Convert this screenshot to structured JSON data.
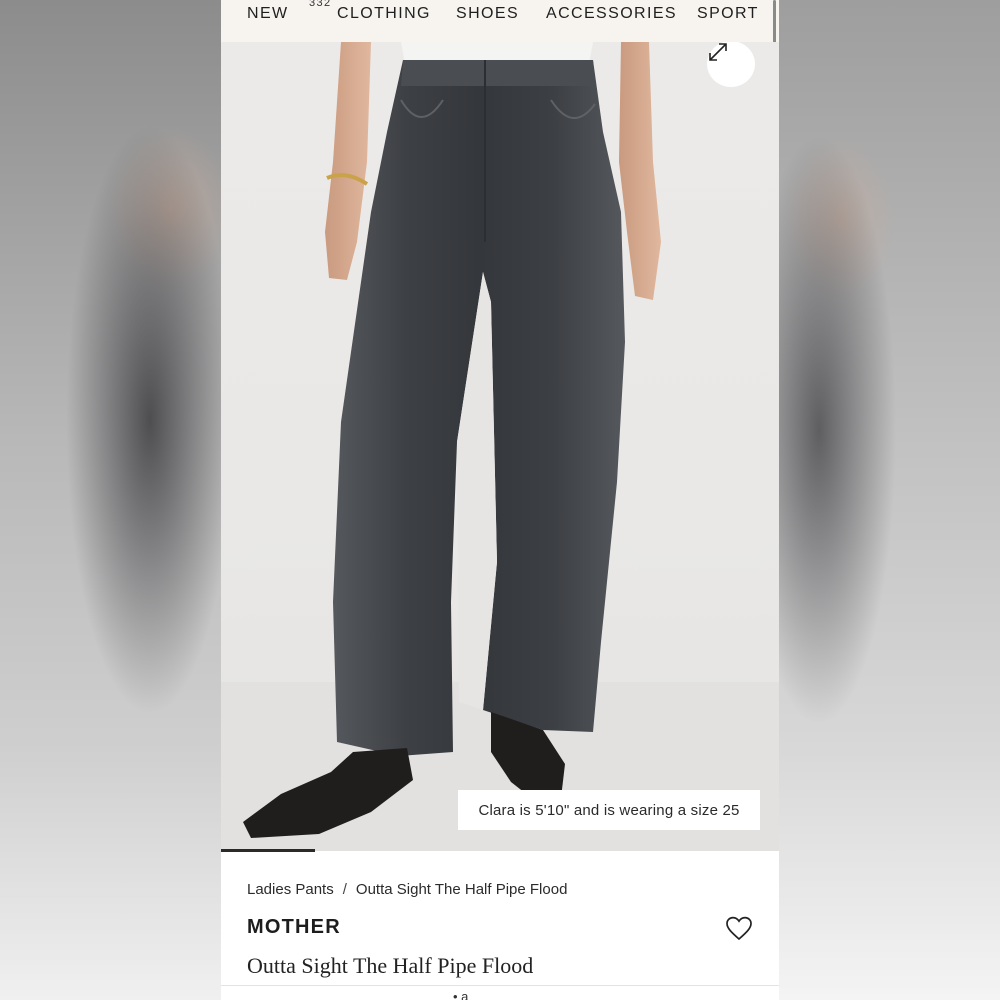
{
  "nav": {
    "items": [
      "NEW",
      "CLOTHING",
      "SHOES",
      "ACCESSORIES",
      "SPORT"
    ],
    "new_badge": "332"
  },
  "hero": {
    "expand_icon": "expand-arrows-icon",
    "caption": "Clara is 5'10\" and is wearing a size 25"
  },
  "breadcrumb": {
    "category": "Ladies Pants",
    "separator": "/",
    "current": "Outta Sight The Half Pipe Flood"
  },
  "product": {
    "brand": "MOTHER",
    "name": "Outta Sight The Half Pipe Flood",
    "wishlist_icon": "heart-icon"
  },
  "peek": {
    "text": "• a"
  },
  "colors": {
    "nav_bg": "#f7f4ef",
    "denim": "#3f4246",
    "text": "#1d1d1d"
  }
}
